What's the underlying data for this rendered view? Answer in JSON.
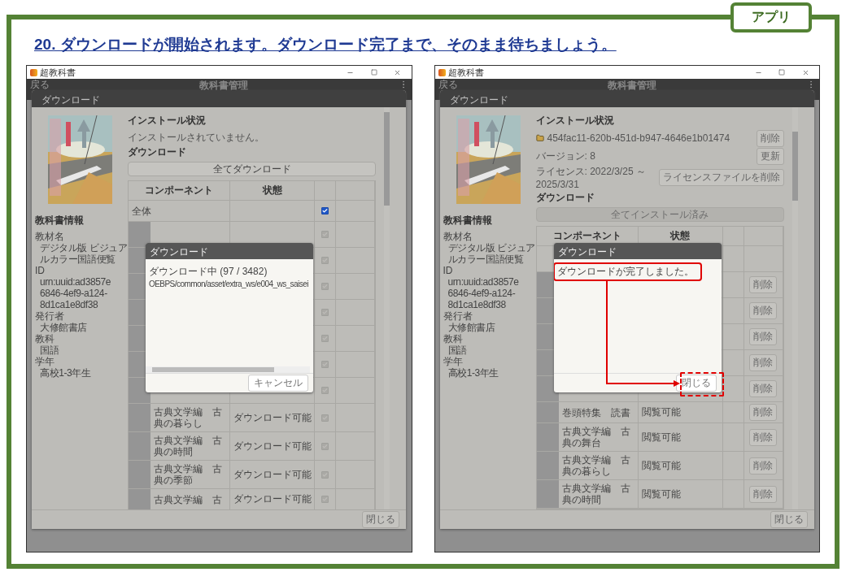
{
  "page": {
    "tag": "アプリ",
    "heading": "20. ダウンロードが開始されます。ダウンロード完了まで、そのまま待ちましょう。"
  },
  "screens": [
    {
      "title": "超教科書",
      "app_bar": {
        "back": "戻る",
        "title": "教科書管理"
      },
      "dialog": {
        "title": "ダウンロード",
        "info": {
          "heading": "教科書情報",
          "fields": [
            {
              "label": "教材名",
              "lines": [
                "デジタル版 ビジュア",
                "ルカラー国語便覧"
              ]
            },
            {
              "label": "ID",
              "lines": [
                "urn:uuid:ad3857e",
                "6846-4ef9-a124-",
                "8d1ca1e8df38"
              ]
            },
            {
              "label": "発行者",
              "lines": [
                "大修館書店"
              ]
            },
            {
              "label": "教科",
              "lines": [
                "国語"
              ]
            },
            {
              "label": "学年",
              "lines": [
                "高校1-3年生"
              ]
            }
          ]
        },
        "install": {
          "heading": "インストール状況",
          "items": [
            {
              "kind": "message",
              "text": "インストールされていません。"
            }
          ]
        },
        "download": {
          "heading": "ダウンロード",
          "button": {
            "label": "全てダウンロード",
            "disabled": false
          }
        },
        "table": {
          "columns": [
            "コンポーネント",
            "状態"
          ],
          "rows": [
            {
              "kind": "all",
              "name": "全体",
              "checked": true,
              "disabled": false
            },
            {
              "kind": "item",
              "checked": true,
              "disabled": true
            },
            {
              "kind": "item",
              "checked": true,
              "disabled": true
            },
            {
              "kind": "item",
              "checked": true,
              "disabled": true
            },
            {
              "kind": "item",
              "checked": true,
              "disabled": true
            },
            {
              "kind": "item",
              "checked": true,
              "disabled": true
            },
            {
              "kind": "item",
              "checked": true,
              "disabled": true
            },
            {
              "kind": "item",
              "checked": true,
              "disabled": true
            },
            {
              "kind": "item",
              "name": "古典文学編　古典の暮らし",
              "status": "ダウンロード可能",
              "checked": true,
              "disabled": true
            },
            {
              "kind": "item",
              "name": "古典文学編　古典の時間",
              "status": "ダウンロード可能",
              "checked": true,
              "disabled": true
            },
            {
              "kind": "item",
              "name": "古典文学編　古典の季節",
              "status": "ダウンロード可能",
              "checked": true,
              "disabled": true
            },
            {
              "kind": "item",
              "name": "古典文学編　古",
              "status": "ダウンロード可能",
              "checked": true,
              "disabled": true
            }
          ]
        },
        "footer_button": "閉じる"
      },
      "modal": {
        "title": "ダウンロード",
        "lines": [
          "ダウンロード中 (97 / 3482)",
          "OEBPS/common/asset/extra_ws/e004_ws_saisei"
        ],
        "h_scrollbar": true,
        "button": "キャンセル",
        "annotated": false
      }
    },
    {
      "title": "超教科書",
      "app_bar": {
        "back": "戻る",
        "title": "教科書管理"
      },
      "dialog": {
        "title": "ダウンロード",
        "info": {
          "heading": "教科書情報",
          "fields": [
            {
              "label": "教材名",
              "lines": [
                "デジタル版 ビジュア",
                "ルカラー国語便覧"
              ]
            },
            {
              "label": "ID",
              "lines": [
                "urn:uuid:ad3857e",
                "6846-4ef9-a124-",
                "8d1ca1e8df38"
              ]
            },
            {
              "label": "発行者",
              "lines": [
                "大修館書店"
              ]
            },
            {
              "label": "教科",
              "lines": [
                "国語"
              ]
            },
            {
              "label": "学年",
              "lines": [
                "高校1-3年生"
              ]
            }
          ]
        },
        "install": {
          "heading": "インストール状況",
          "items": [
            {
              "kind": "folder",
              "text": "454fac11-620b-451d-b947-4646e1b01474",
              "button": "削除"
            },
            {
              "kind": "message",
              "text": "バージョン: 8",
              "button": "更新"
            },
            {
              "kind": "message",
              "text": "ライセンス: 2022/3/25 ～ 2025/3/31",
              "button": "ライセンスファイルを削除"
            }
          ]
        },
        "download": {
          "heading": "ダウンロード",
          "button": {
            "label": "全てインストール済み",
            "disabled": true
          }
        },
        "table": {
          "columns": [
            "コンポーネント",
            "状態"
          ],
          "rows": [
            {
              "kind": "all"
            },
            {
              "kind": "item",
              "action": "削除"
            },
            {
              "kind": "item",
              "action": "削除"
            },
            {
              "kind": "item",
              "action": "削除"
            },
            {
              "kind": "item",
              "action": "削除"
            },
            {
              "kind": "item",
              "action": "削除"
            },
            {
              "kind": "item",
              "name": "巻頭特集　読書",
              "status": "閲覧可能",
              "action": "削除"
            },
            {
              "kind": "item",
              "name": "古典文学編　古典の舞台",
              "status": "閲覧可能",
              "action": "削除"
            },
            {
              "kind": "item",
              "name": "古典文学編　古典の暮らし",
              "status": "閲覧可能",
              "action": "削除"
            },
            {
              "kind": "item",
              "name": "古典文学編　古典の時間",
              "status": "閲覧可能",
              "action": "削除"
            }
          ]
        },
        "footer_button": "閉じる"
      },
      "modal": {
        "title": "ダウンロード",
        "lines": [
          "ダウンロードが完了しました。"
        ],
        "h_scrollbar": false,
        "button": "閉じる",
        "annotated": true
      }
    }
  ]
}
